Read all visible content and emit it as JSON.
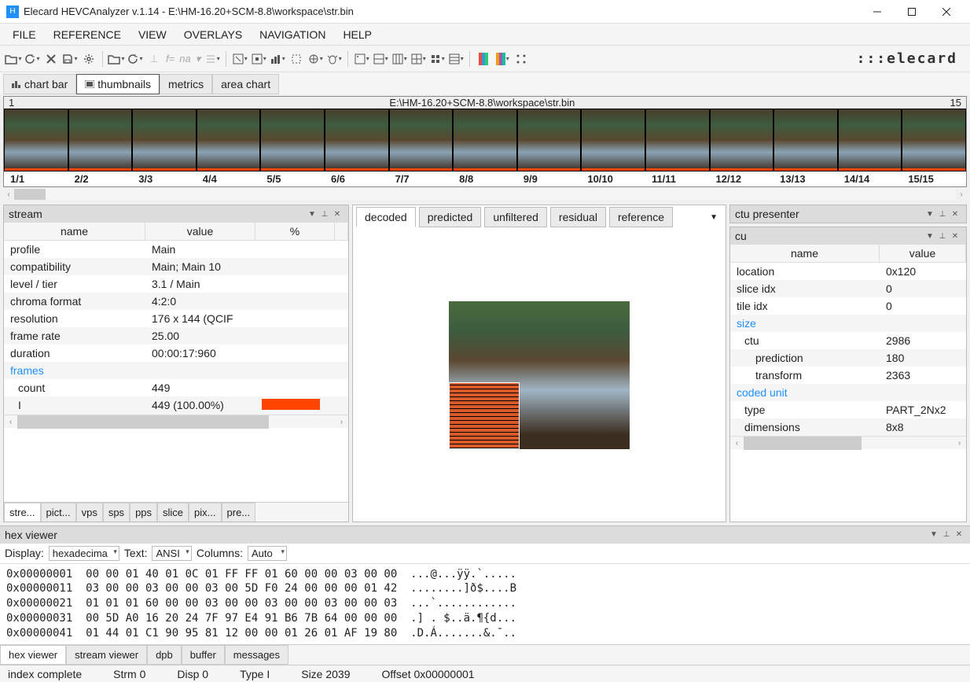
{
  "window": {
    "title": "Elecard HEVCAnalyzer v.1.14 - E:\\HM-16.20+SCM-8.8\\workspace\\str.bin"
  },
  "menu": [
    "FILE",
    "REFERENCE",
    "VIEW",
    "OVERLAYS",
    "NAVIGATION",
    "HELP"
  ],
  "toolbar_text": {
    "fx": "f=",
    "na": "na"
  },
  "logo": "elecard",
  "viewtabs": [
    {
      "label": "chart bar"
    },
    {
      "label": "thumbnails"
    },
    {
      "label": "metrics"
    },
    {
      "label": "area chart"
    }
  ],
  "thumb": {
    "left": "1",
    "path": "E:\\HM-16.20+SCM-8.8\\workspace\\str.bin",
    "right": "15",
    "labels": [
      "1/1",
      "2/2",
      "3/3",
      "4/4",
      "5/5",
      "6/6",
      "7/7",
      "8/8",
      "9/9",
      "10/10",
      "11/11",
      "12/12",
      "13/13",
      "14/14",
      "15/15"
    ]
  },
  "stream": {
    "title": "stream",
    "cols": [
      "name",
      "value",
      "%"
    ],
    "rows": [
      {
        "n": "profile",
        "v": "Main",
        "p": ""
      },
      {
        "n": "compatibility",
        "v": "Main; Main 10",
        "p": ""
      },
      {
        "n": "level / tier",
        "v": "3.1 / Main",
        "p": ""
      },
      {
        "n": "chroma format",
        "v": "4:2:0",
        "p": ""
      },
      {
        "n": "resolution",
        "v": "176 x 144 (QCIF",
        "p": ""
      },
      {
        "n": "frame rate",
        "v": "25.00",
        "p": ""
      },
      {
        "n": "duration",
        "v": "00:00:17:960",
        "p": ""
      },
      {
        "n": "frames",
        "v": "",
        "p": "",
        "link": true
      },
      {
        "n": "count",
        "v": "449",
        "p": "",
        "indent": 1
      },
      {
        "n": "I",
        "v": "449 (100.00%)",
        "p": "bar",
        "indent": 1
      }
    ],
    "subtabs": [
      "stre...",
      "pict...",
      "vps",
      "sps",
      "pps",
      "slice",
      "pix...",
      "pre..."
    ]
  },
  "center": {
    "tabs": [
      "decoded",
      "predicted",
      "unfiltered",
      "residual",
      "reference"
    ]
  },
  "ctu": {
    "title": "ctu presenter"
  },
  "cu": {
    "title": "cu",
    "cols": [
      "name",
      "value"
    ],
    "rows": [
      {
        "n": "location",
        "v": "0x120"
      },
      {
        "n": "slice idx",
        "v": "0"
      },
      {
        "n": "tile idx",
        "v": "0"
      },
      {
        "n": "size",
        "v": "",
        "link": true
      },
      {
        "n": "ctu",
        "v": "2986",
        "indent": 1
      },
      {
        "n": "prediction",
        "v": "180",
        "indent": 2
      },
      {
        "n": "transform",
        "v": "2363",
        "indent": 2
      },
      {
        "n": "coded unit",
        "v": "",
        "link": true
      },
      {
        "n": "type",
        "v": "PART_2Nx2",
        "indent": 1
      },
      {
        "n": "dimensions",
        "v": "8x8",
        "indent": 1
      }
    ]
  },
  "hex": {
    "title": "hex viewer",
    "display_lbl": "Display:",
    "display_val": "hexadecima",
    "text_lbl": "Text:",
    "text_val": "ANSI",
    "cols_lbl": "Columns:",
    "cols_val": "Auto",
    "lines": [
      "0x00000001  00 00 01 40 01 0C 01 FF FF 01 60 00 00 03 00 00  ...@...ÿÿ.`.....",
      "0x00000011  03 00 00 03 00 00 03 00 5D F0 24 00 00 00 01 42  ........]ð$....B",
      "0x00000021  01 01 01 60 00 00 03 00 00 03 00 00 03 00 00 03  ...`............",
      "0x00000031  00 5D A0 16 20 24 7F 97 E4 91 B6 7B 64 00 00 00  .] . $..ä.¶{d...",
      "0x00000041  01 44 01 C1 90 95 81 12 00 00 01 26 01 AF 19 80  .D.Á.......&.¯.."
    ],
    "bottomtabs": [
      "hex viewer",
      "stream viewer",
      "dpb",
      "buffer",
      "messages"
    ]
  },
  "status": {
    "s1": "index complete",
    "s2": "Strm 0",
    "s3": "Disp 0",
    "s4": "Type I",
    "s5": "Size 2039",
    "s6": "Offset 0x00000001"
  }
}
